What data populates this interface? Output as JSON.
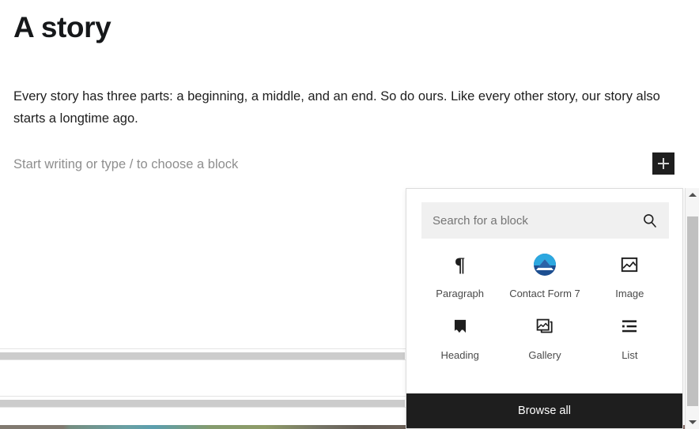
{
  "editor": {
    "post_title": "A story",
    "paragraph": "Every story has three parts: a beginning, a middle, and an end. So do ours. Like every other story, our story also starts a longtime ago.",
    "empty_block_prompt": "Start writing or type / to choose a block",
    "add_block_button_label": "+",
    "add_block_icon": "plus-icon"
  },
  "inserter": {
    "search": {
      "placeholder": "Search for a block",
      "value": "",
      "icon": "search-icon"
    },
    "blocks": [
      {
        "label": "Paragraph",
        "icon": "paragraph-pilcrow-icon"
      },
      {
        "label": "Contact Form 7",
        "icon": "contact-form-7-logo-icon"
      },
      {
        "label": "Image",
        "icon": "image-icon"
      },
      {
        "label": "Heading",
        "icon": "heading-bookmark-icon"
      },
      {
        "label": "Gallery",
        "icon": "gallery-icon"
      },
      {
        "label": "List",
        "icon": "list-icon"
      }
    ],
    "footer": {
      "browse_all_label": "Browse all"
    }
  },
  "scrollbar": {
    "up_arrow_icon": "chevron-up-icon",
    "down_arrow_icon": "chevron-down-icon"
  },
  "colors": {
    "editor_text": "#1e1e1e",
    "placeholder_text": "#8e8e8e",
    "panel_background": "#ffffff",
    "panel_border": "#dcdcdc",
    "search_field_background": "#f0f0f0",
    "footer_background": "#1e1e1e",
    "footer_text": "#ffffff",
    "add_block_background": "#1e1e1e",
    "skeleton_bar": "#cccccc",
    "cf7_circle": "#1d4f91",
    "cf7_sky": "#2ca8e0",
    "scrollbar_thumb": "#c0c0c0"
  }
}
